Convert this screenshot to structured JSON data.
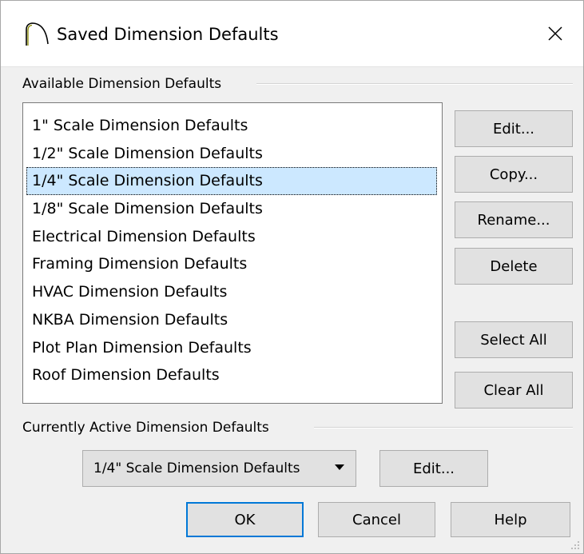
{
  "window": {
    "title": "Saved Dimension Defaults",
    "close_glyph": "✕"
  },
  "available": {
    "group_label": "Available Dimension Defaults",
    "items": [
      "1\" Scale Dimension Defaults",
      "1/2\" Scale Dimension Defaults",
      "1/4\" Scale Dimension Defaults",
      "1/8\" Scale Dimension Defaults",
      "Electrical Dimension Defaults",
      "Framing Dimension Defaults",
      "HVAC Dimension Defaults",
      "NKBA Dimension Defaults",
      "Plot Plan Dimension Defaults",
      "Roof Dimension Defaults"
    ],
    "selected_index": 2,
    "buttons": {
      "edit": "Edit...",
      "copy": "Copy...",
      "rename": "Rename...",
      "delete": "Delete",
      "select_all": "Select All",
      "clear_all": "Clear All"
    }
  },
  "active": {
    "group_label": "Currently Active Dimension Defaults",
    "selected_value": "1/4\" Scale Dimension Defaults",
    "edit_label": "Edit..."
  },
  "footer": {
    "ok": "OK",
    "cancel": "Cancel",
    "help": "Help"
  },
  "colors": {
    "selection": "#cce8ff",
    "default_button_border": "#0078d7",
    "dialog_bg": "#f0f0f0"
  },
  "icons": {
    "app": "arc-icon",
    "close": "close-icon",
    "dropdown": "caret-down-icon",
    "resize": "resize-grip-icon"
  }
}
